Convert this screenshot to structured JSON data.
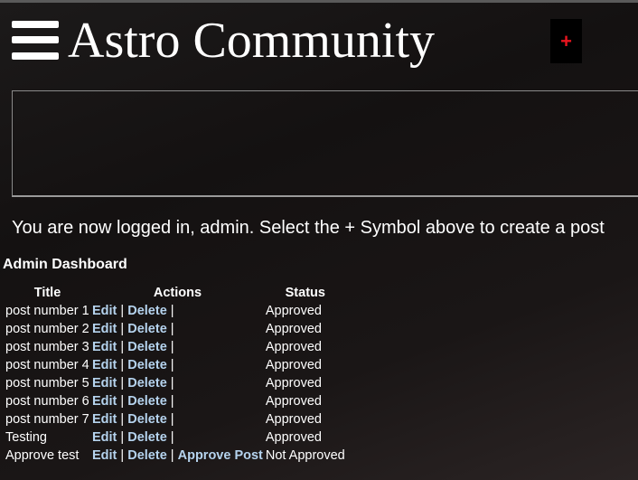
{
  "header": {
    "title": "Astro Community",
    "add_post_symbol": "+",
    "menu_icon": "hamburger-menu-icon",
    "add_post_color": "#e8141e"
  },
  "message": "You are now logged in, admin. Select the + Symbol above to create a post",
  "dashboard": {
    "heading": "Admin Dashboard",
    "columns": [
      "Title",
      "Actions",
      "Status"
    ],
    "edit_label": "Edit",
    "delete_label": "Delete",
    "separator": "|",
    "rows": [
      {
        "title": "post number 1",
        "edit": "Edit",
        "delete": "Delete",
        "approve": "",
        "status": "Approved"
      },
      {
        "title": "post number 2",
        "edit": "Edit",
        "delete": "Delete",
        "approve": "",
        "status": "Approved"
      },
      {
        "title": "post number 3",
        "edit": "Edit",
        "delete": "Delete",
        "approve": "",
        "status": "Approved"
      },
      {
        "title": "post number 4",
        "edit": "Edit",
        "delete": "Delete",
        "approve": "",
        "status": "Approved"
      },
      {
        "title": "post number 5",
        "edit": "Edit",
        "delete": "Delete",
        "approve": "",
        "status": "Approved"
      },
      {
        "title": "post number 6",
        "edit": "Edit",
        "delete": "Delete",
        "approve": "",
        "status": "Approved"
      },
      {
        "title": "post number 7",
        "edit": "Edit",
        "delete": "Delete",
        "approve": "",
        "status": "Approved"
      },
      {
        "title": "Testing",
        "edit": "Edit",
        "delete": "Delete",
        "approve": "",
        "status": "Approved"
      },
      {
        "title": "Approve test",
        "edit": "Edit",
        "delete": "Delete",
        "approve": "Approve Post",
        "status": "Not Approved"
      }
    ],
    "link_color": "#b5d3ee"
  }
}
